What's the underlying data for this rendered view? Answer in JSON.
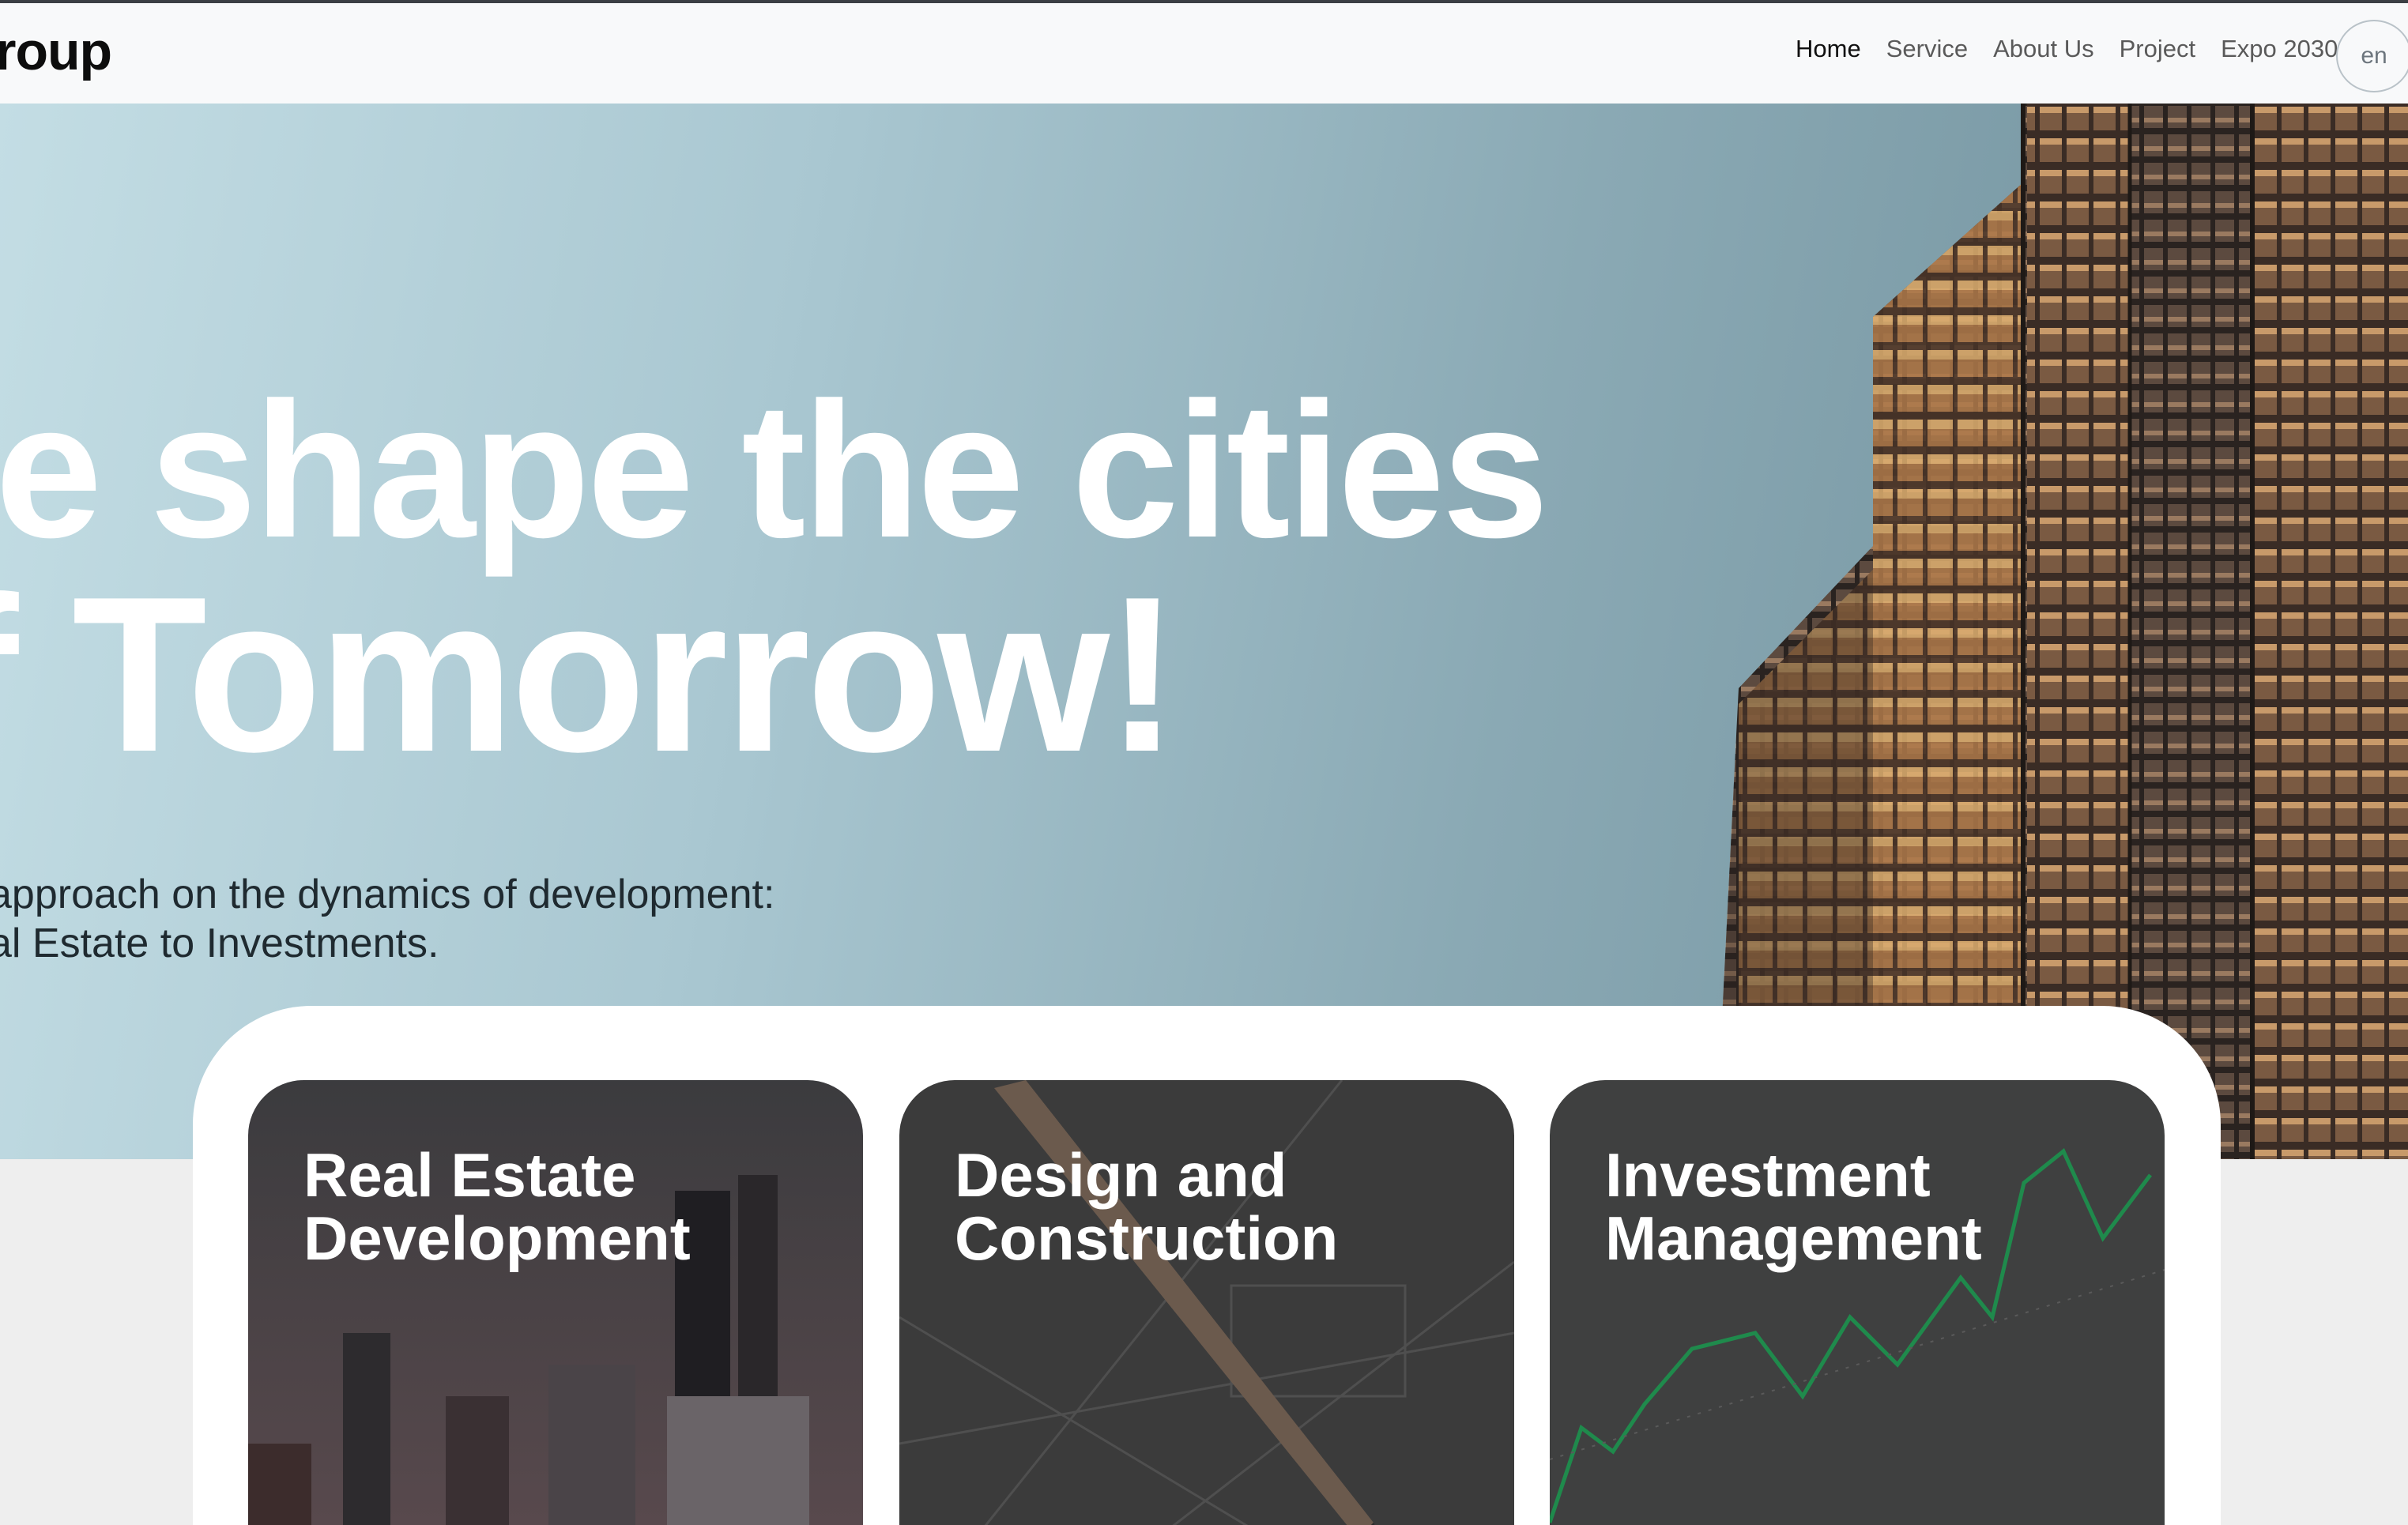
{
  "brand": {
    "logo_text": "roup"
  },
  "nav": {
    "items": [
      {
        "label": "Home",
        "active": true
      },
      {
        "label": "Service",
        "active": false
      },
      {
        "label": "About Us",
        "active": false
      },
      {
        "label": "Project",
        "active": false
      },
      {
        "label": "Expo 2030",
        "active": false
      }
    ],
    "language": "en"
  },
  "hero": {
    "headline_line1": "/e shape the cities",
    "headline_line2": "f Tomorrow!",
    "subtitle_line1": "approach on the dynamics of development:",
    "subtitle_line2": "al Estate to Investments."
  },
  "services": {
    "cards": [
      {
        "title": "Real Estate\nDevelopment"
      },
      {
        "title": "Design and\nConstruction"
      },
      {
        "title": "Investment\nManagement"
      }
    ]
  },
  "colors": {
    "hero_gradient_start": "#c3dde4",
    "hero_gradient_end": "#6d8d99",
    "card_overlay": "#3a3a3a",
    "chart_line": "#1f8a4c"
  }
}
